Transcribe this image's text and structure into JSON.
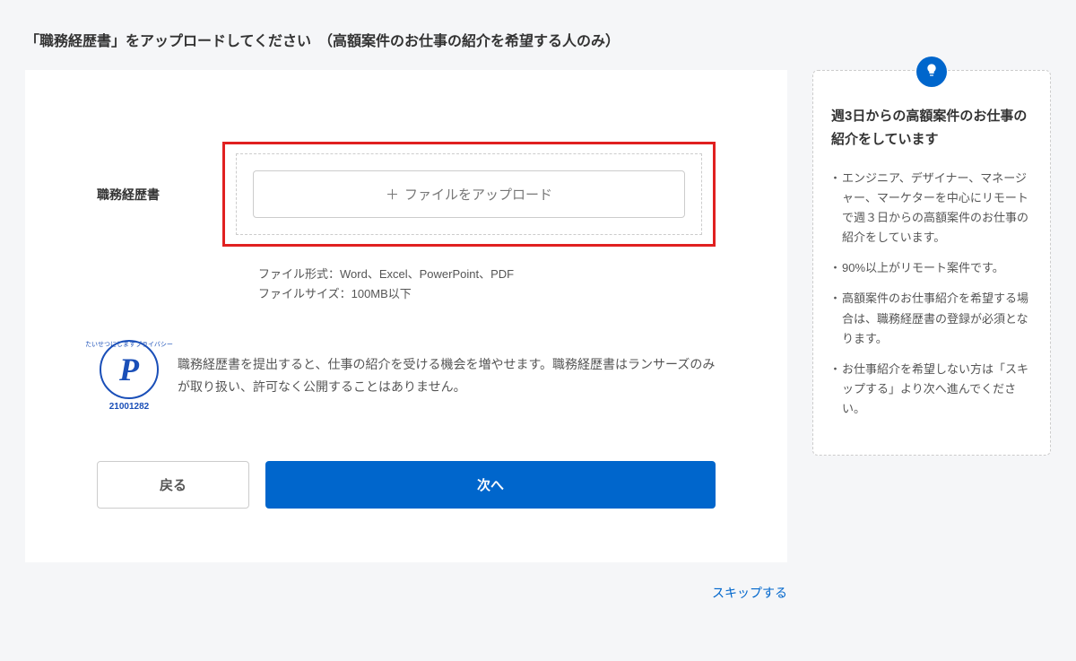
{
  "page": {
    "title": "「職務経歴書」をアップロードしてください　（高額案件のお仕事の紹介を希望する人のみ）"
  },
  "form": {
    "field_label": "職務経歴書",
    "upload_button": "ファイルをアップロード",
    "file_format": "ファイル形式：Word、Excel、PowerPoint、PDF",
    "file_size": "ファイルサイズ：100MB以下"
  },
  "privacy": {
    "mark_arc": "たいせつにしますプライバシー",
    "mark_number": "21001282",
    "text": "職務経歴書を提出すると、仕事の紹介を受ける機会を増やせます。職務経歴書はランサーズのみが取り扱い、許可なく公開することはありません。"
  },
  "buttons": {
    "back": "戻る",
    "next": "次へ",
    "skip": "スキップする"
  },
  "sidebar": {
    "title": "週3日からの高額案件のお仕事の紹介をしています",
    "items": [
      "エンジニア、デザイナー、マネージャー、マーケターを中心にリモートで週３日からの高額案件のお仕事の紹介をしています。",
      "90%以上がリモート案件です。",
      "高額案件のお仕事紹介を希望する場合は、職務経歴書の登録が必須となります。",
      "お仕事紹介を希望しない方は「スキップする」より次へ進んでください。"
    ]
  }
}
